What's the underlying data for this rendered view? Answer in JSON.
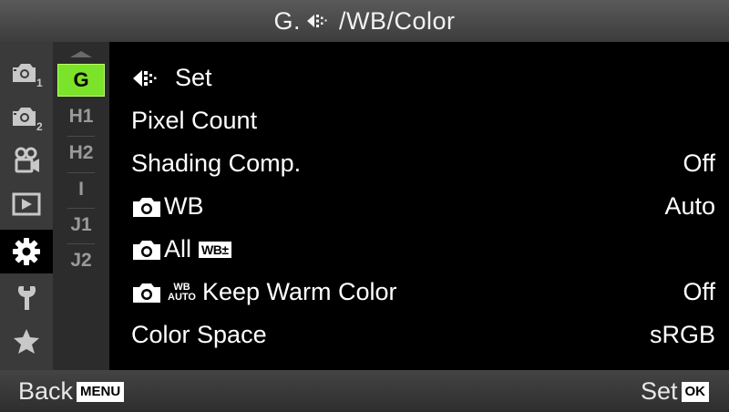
{
  "header": {
    "title_prefix": "G.",
    "title_suffix": "/WB/Color"
  },
  "categories": [
    {
      "name": "shooting-menu-1",
      "sub": "1"
    },
    {
      "name": "shooting-menu-2",
      "sub": "2"
    },
    {
      "name": "video-menu"
    },
    {
      "name": "playback-menu"
    },
    {
      "name": "custom-menu",
      "active": true
    },
    {
      "name": "setup-menu"
    },
    {
      "name": "my-menu"
    }
  ],
  "submenu": {
    "items": [
      "G",
      "H1",
      "H2",
      "I",
      "J1",
      "J2"
    ],
    "active_color": "#7be32a"
  },
  "menu": {
    "rows": [
      {
        "label": "Set",
        "value": ""
      },
      {
        "label": "Pixel Count",
        "value": ""
      },
      {
        "label": "Shading Comp.",
        "value": "Off"
      },
      {
        "label": "WB",
        "value": "Auto"
      },
      {
        "label": "All",
        "badge": "WB±",
        "value": ""
      },
      {
        "label": "Keep Warm Color",
        "wb_top": "WB",
        "wb_bottom": "AUTO",
        "value": "Off"
      },
      {
        "label": "Color Space",
        "value": "sRGB"
      }
    ]
  },
  "footer": {
    "back_label": "Back",
    "back_key": "MENU",
    "set_label": "Set",
    "set_key": "OK"
  }
}
